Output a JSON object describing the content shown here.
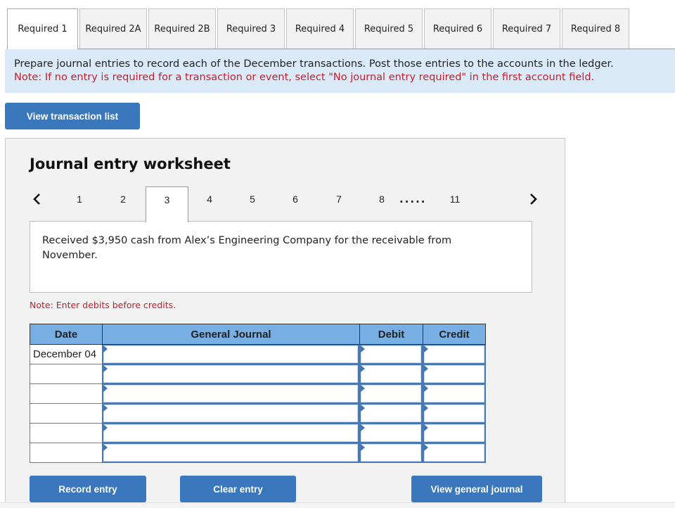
{
  "tabs": [
    {
      "label": "Required 1",
      "active": true
    },
    {
      "label": "Required 2A",
      "active": false
    },
    {
      "label": "Required 2B",
      "active": false
    },
    {
      "label": "Required 3",
      "active": false
    },
    {
      "label": "Required 4",
      "active": false
    },
    {
      "label": "Required 5",
      "active": false
    },
    {
      "label": "Required 6",
      "active": false
    },
    {
      "label": "Required 7",
      "active": false
    },
    {
      "label": "Required 8",
      "active": false
    }
  ],
  "instructions": {
    "main": "Prepare journal entries to record each of the December transactions. Post those entries to the accounts in the ledger.",
    "note": "Note: If no entry is required for a transaction or event, select \"No journal entry required\" in the first account field."
  },
  "buttons": {
    "view_transaction_list": "View transaction list",
    "record_entry": "Record entry",
    "clear_entry": "Clear entry",
    "view_general_journal": "View general journal"
  },
  "worksheet": {
    "title": "Journal entry worksheet",
    "pager": {
      "prev_icon": "chevron-left-icon",
      "next_icon": "chevron-right-icon",
      "pages": [
        "1",
        "2",
        "3",
        "4",
        "5",
        "6",
        "7",
        "8"
      ],
      "ellipsis": ".....",
      "last_page": "11",
      "current": "3"
    },
    "description": "Received $3,950 cash from Alex’s Engineering Company for the receivable from November.",
    "debit_note": "Note: Enter debits before credits.",
    "table": {
      "headers": {
        "date": "Date",
        "account": "General Journal",
        "debit": "Debit",
        "credit": "Credit"
      },
      "rows": [
        {
          "date": "December 04",
          "account": "",
          "debit": "",
          "credit": ""
        },
        {
          "date": "",
          "account": "",
          "debit": "",
          "credit": ""
        },
        {
          "date": "",
          "account": "",
          "debit": "",
          "credit": ""
        },
        {
          "date": "",
          "account": "",
          "debit": "",
          "credit": ""
        },
        {
          "date": "",
          "account": "",
          "debit": "",
          "credit": ""
        },
        {
          "date": "",
          "account": "",
          "debit": "",
          "credit": ""
        }
      ]
    }
  },
  "colors": {
    "accent_button": "#3a77bd",
    "table_header": "#77aee3",
    "instruction_bg": "#dbeaf8",
    "note_red": "#c2212b"
  }
}
